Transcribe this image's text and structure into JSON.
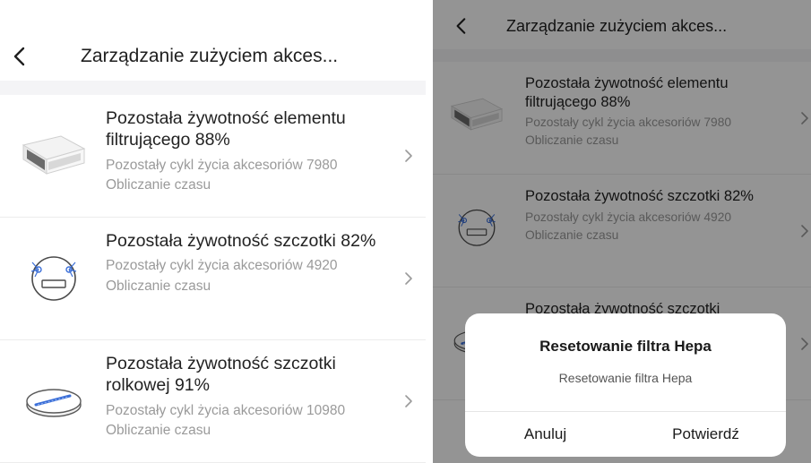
{
  "left": {
    "header": {
      "title": "Zarządzanie zużyciem akces..."
    },
    "items": [
      {
        "title": "Pozostała żywotność elementu filtrującego 88%",
        "sub1": "Pozostały cykl życia akcesoriów 7980",
        "sub2": "Obliczanie czasu",
        "icon": "filter-icon"
      },
      {
        "title": "Pozostała żywotność szczotki 82%",
        "sub1": "Pozostały cykl życia akcesoriów 4920",
        "sub2": "Obliczanie czasu",
        "icon": "side-brush-icon"
      },
      {
        "title": "Pozostała żywotność szczotki rolkowej 91%",
        "sub1": "Pozostały cykl życia akcesoriów 10980",
        "sub2": "Obliczanie czasu",
        "icon": "roller-brush-icon"
      }
    ]
  },
  "right": {
    "header": {
      "title": "Zarządzanie zużyciem akces..."
    },
    "items": [
      {
        "title": "Pozostała żywotność elementu filtrującego 88%",
        "sub1": "Pozostały cykl życia akcesoriów 7980",
        "sub2": "Obliczanie czasu",
        "icon": "filter-icon"
      },
      {
        "title": "Pozostała żywotność szczotki 82%",
        "sub1": "Pozostały cykl życia akcesoriów 4920",
        "sub2": "Obliczanie czasu",
        "icon": "side-brush-icon"
      },
      {
        "title": "Pozostała żywotność szczotki",
        "sub1": "",
        "sub2": "",
        "icon": "roller-brush-icon"
      }
    ],
    "dialog": {
      "title": "Resetowanie filtra Hepa",
      "message": "Resetowanie filtra Hepa",
      "cancel_label": "Anuluj",
      "confirm_label": "Potwierdź"
    }
  },
  "colors": {
    "text_primary": "#1f1f1f",
    "text_secondary": "#9a9a9a",
    "section_bg": "#f4f4f6",
    "overlay": "rgba(0,0,0,0.42)"
  }
}
